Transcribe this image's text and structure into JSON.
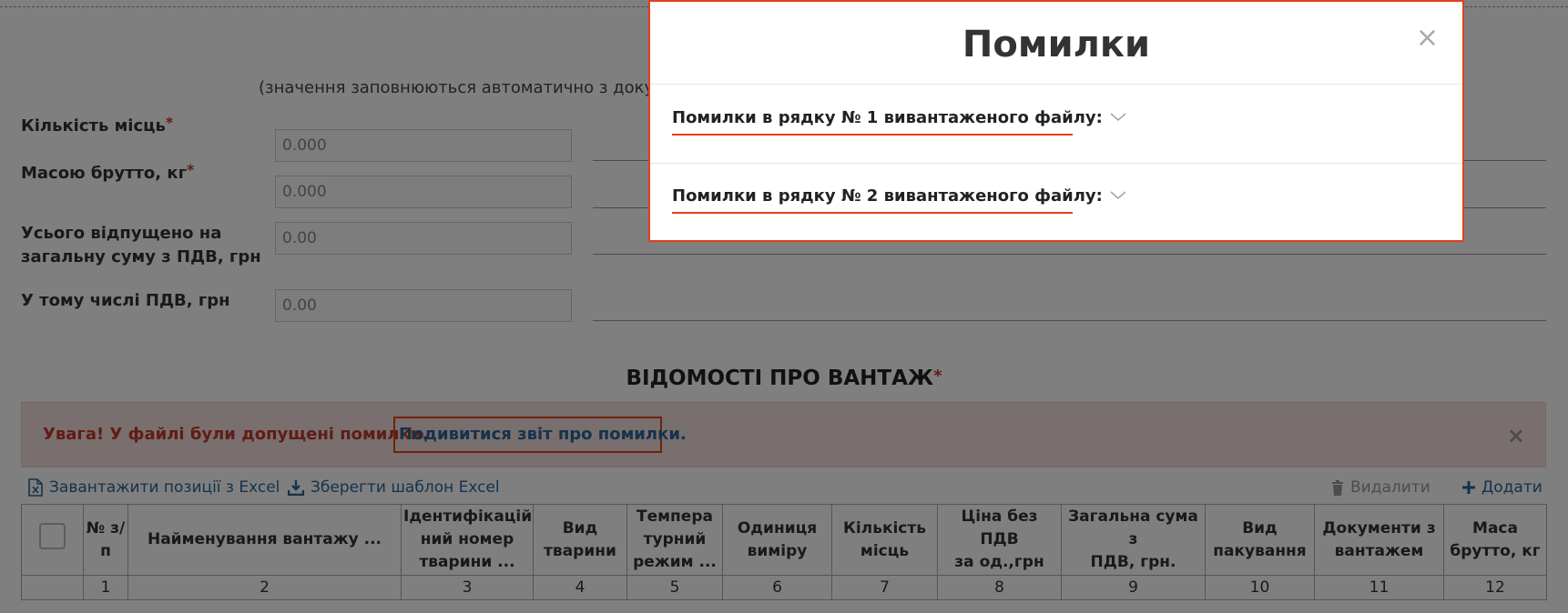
{
  "form": {
    "auto_note": "(значення заповнюються автоматично з докуме",
    "fields": [
      {
        "label": "Кількість місць",
        "required": "*",
        "value": "0.000"
      },
      {
        "label": "Масою брутто, кг",
        "required": "*",
        "value": "0.000"
      },
      {
        "label_line1": "Усього відпущено на",
        "label_line2": "загальну суму з ПДВ, грн",
        "value": "0.00"
      },
      {
        "label": "У тому числі ПДВ, грн",
        "value": "0.00"
      }
    ]
  },
  "cargo": {
    "title": "ВІДОМОСТІ ПРО ВАНТАЖ",
    "required": "*"
  },
  "alert": {
    "text": "Увага! У файлі були допущені помилки.",
    "link": "Подивитися звіт про помилки.",
    "close": "×"
  },
  "toolbar": {
    "load_excel": "Завантажити позиції з Excel",
    "save_template": "Зберегти шаблон Excel",
    "delete": "Видалити",
    "add": "Додати"
  },
  "table": {
    "headers": [
      {
        "l1": "№ з/",
        "l2": "п"
      },
      {
        "l1": "Найменування вантажу ..."
      },
      {
        "l1": "Ідентифікацій",
        "l2": "ний номер",
        "l3": "тварини ..."
      },
      {
        "l1": "Вид",
        "l2": "тварини"
      },
      {
        "l1": "Темпера",
        "l2": "турний",
        "l3": "режим ..."
      },
      {
        "l1": "Одиниця",
        "l2": "виміру"
      },
      {
        "l1": "Кількість",
        "l2": "місць"
      },
      {
        "l1": "Ціна без ПДВ",
        "l2": "за од.,грн"
      },
      {
        "l1": "Загальна сума з",
        "l2": "ПДВ, грн."
      },
      {
        "l1": "Вид",
        "l2": "пакування"
      },
      {
        "l1": "Документи з",
        "l2": "вантажем"
      },
      {
        "l1": "Маса",
        "l2": "брутто, кг"
      }
    ],
    "numbers": [
      "1",
      "2",
      "3",
      "4",
      "5",
      "6",
      "7",
      "8",
      "9",
      "10",
      "11",
      "12"
    ]
  },
  "modal": {
    "title": "Помилки",
    "close": "×",
    "errors": [
      "Помилки в рядку № 1 вивантаженого файлу:",
      "Помилки в рядку № 2 вивантаженого файлу:"
    ]
  },
  "colors": {
    "accent_red": "#e2401c",
    "alert_bg": "#f2dede",
    "link_blue": "#2a6496"
  },
  "icons": {
    "load": "excel-file-icon",
    "save": "download-icon",
    "delete": "trash-icon",
    "add": "plus-icon",
    "expand": "chevron-down-icon"
  }
}
